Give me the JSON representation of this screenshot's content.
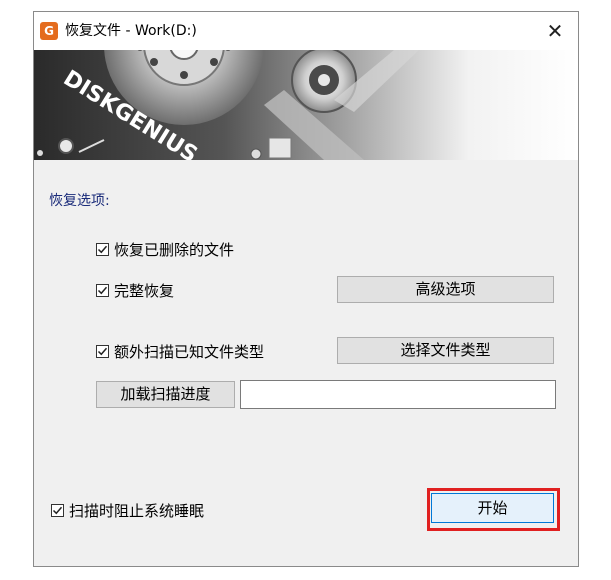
{
  "window": {
    "title": "恢复文件 - Work(D:)",
    "app_icon_letter": "G",
    "close_glyph": "✕"
  },
  "banner": {
    "brand_text": "DISKGENIUS"
  },
  "options": {
    "section_title": "恢复选项:",
    "restore_deleted": {
      "label": "恢复已删除的文件",
      "checked": true
    },
    "full_restore": {
      "label": "完整恢复",
      "checked": true
    },
    "extra_scan": {
      "label": "额外扫描已知文件类型",
      "checked": true
    },
    "prevent_sleep": {
      "label": "扫描时阻止系统睡眠",
      "checked": true
    }
  },
  "buttons": {
    "advanced": "高级选项",
    "select_types": "选择文件类型",
    "load_progress": "加载扫描进度",
    "start": "开始"
  },
  "inputs": {
    "progress_path": {
      "value": ""
    }
  },
  "colors": {
    "section_title": "#1a2b7a",
    "highlight_border": "#e02020",
    "default_button_border": "#0078d7",
    "app_icon": "#e46c1e"
  }
}
